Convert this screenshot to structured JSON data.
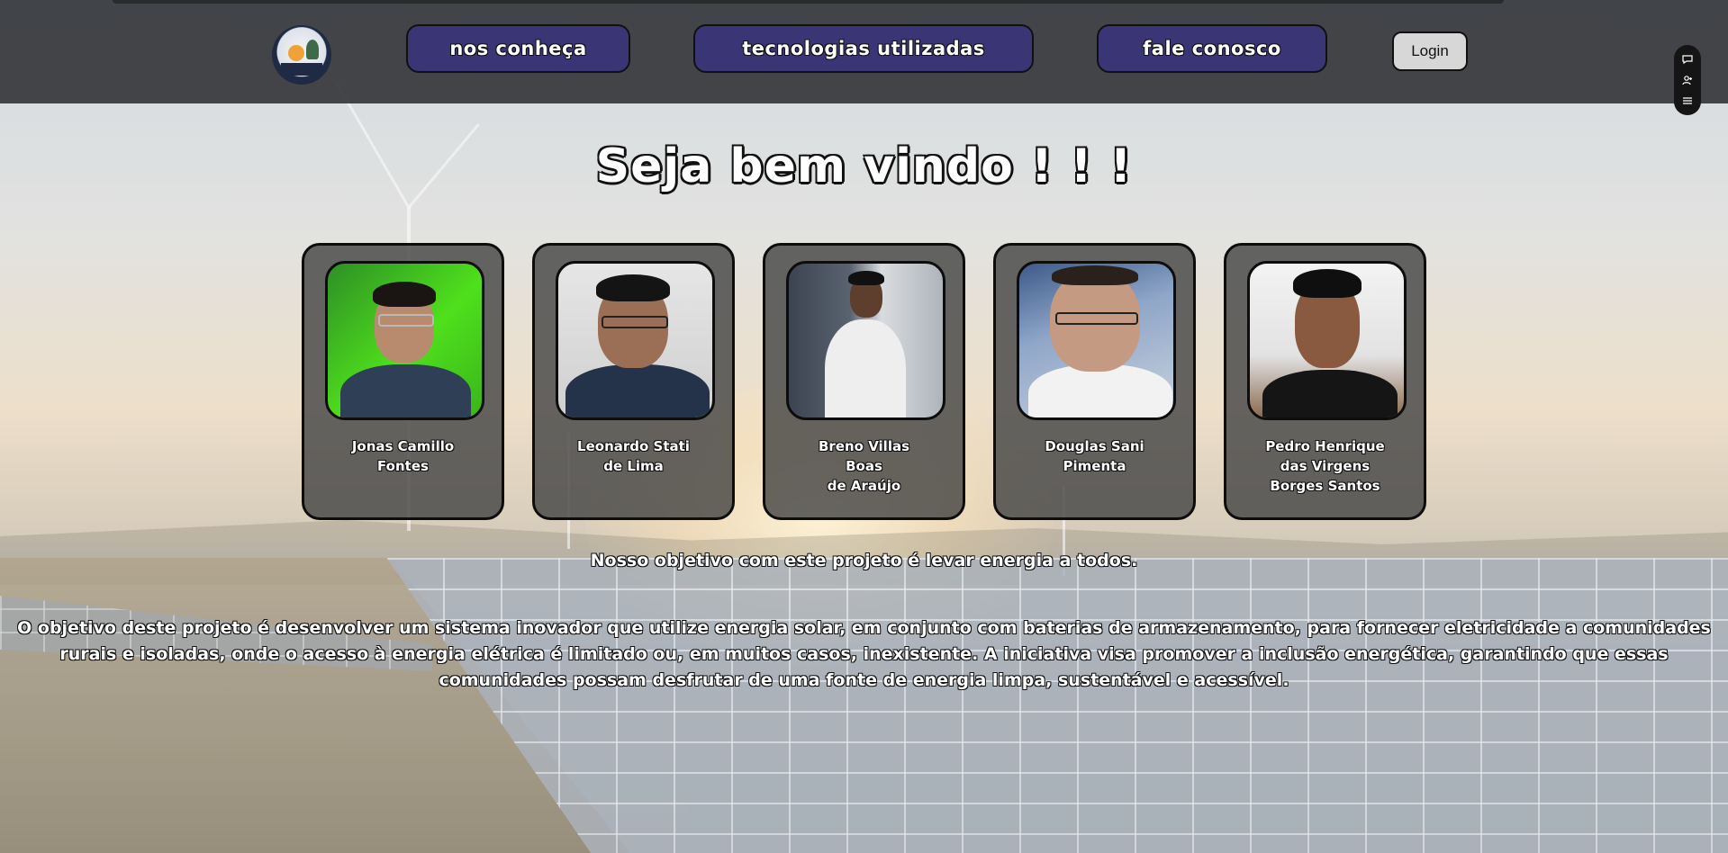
{
  "header": {
    "logo_icon": "solar-wind-logo-icon",
    "nav": [
      {
        "label": "nos conheça"
      },
      {
        "label": "tecnologias utilizadas"
      },
      {
        "label": "fale conosco"
      }
    ],
    "login_label": "Login"
  },
  "side_toolbar": {
    "icons": [
      "chat-bubble-icon",
      "user-add-icon",
      "menu-icon"
    ]
  },
  "main": {
    "welcome_title": "Seja bem vindo ! ! !",
    "team": [
      {
        "name": "Jonas Camillo\nFontes",
        "photo_icon": "person-photo"
      },
      {
        "name": "Leonardo Stati\nde Lima",
        "photo_icon": "person-photo"
      },
      {
        "name": "Breno Villas\nBoas\nde Araújo",
        "photo_icon": "person-photo"
      },
      {
        "name": "Douglas Sani\nPimenta",
        "photo_icon": "person-photo"
      },
      {
        "name": "Pedro Henrique\ndas Virgens\nBorges Santos",
        "photo_icon": "person-photo"
      }
    ],
    "objective": "Nosso objetivo com este projeto é levar energia a todos.",
    "description": "O objetivo deste projeto é desenvolver um sistema inovador que utilize energia solar, em conjunto com baterias de armazenamento, para fornecer eletricidade a comunidades rurais e isoladas, onde o acesso à energia elétrica é limitado ou, em muitos casos, inexistente. A iniciativa visa promover a inclusão energética, garantindo que essas comunidades possam desfrutar de uma fonte de energia limpa, sustentável e acessível."
  },
  "colors": {
    "nav_button": "#3a3575",
    "header_bg": "#37393c",
    "card_bg": "#464646",
    "login_bg": "#d7d7d7"
  }
}
